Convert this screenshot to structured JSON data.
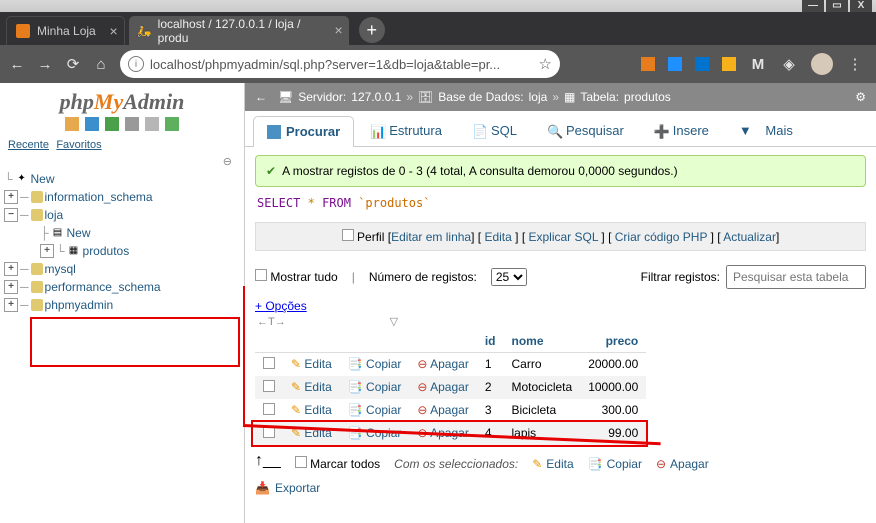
{
  "window_buttons": {
    "min": "—",
    "max": "▭",
    "close": "X"
  },
  "browser_tabs": [
    {
      "label": "Minha Loja"
    },
    {
      "label": "localhost / 127.0.0.1 / loja / produ"
    }
  ],
  "url": "localhost/phpmyadmin/sql.php?server=1&db=loja&table=pr...",
  "logo": {
    "php": "php",
    "my": "My",
    "admin": "Admin"
  },
  "sidebar_tabs": {
    "recent": "Recente",
    "fav": "Favoritos"
  },
  "tree": {
    "new": "New",
    "dbs": [
      "information_schema",
      "loja",
      "mysql",
      "performance_schema",
      "phpmyadmin"
    ],
    "loja_new": "New",
    "loja_table": "produtos"
  },
  "breadcrumb": {
    "server_label": "Servidor:",
    "server": "127.0.0.1",
    "db_label": "Base de Dados:",
    "db": "loja",
    "table_label": "Tabela:",
    "table": "produtos"
  },
  "tabs": {
    "browse": "Procurar",
    "structure": "Estrutura",
    "sql": "SQL",
    "search": "Pesquisar",
    "insert": "Insere",
    "more": "Mais"
  },
  "alert": "A mostrar registos de 0 - 3 (4 total, A consulta demorou 0,0000 segundos.)",
  "sql": {
    "select": "SELECT",
    "star": "*",
    "from": "FROM",
    "tbl": "`produtos`"
  },
  "inline": {
    "profile": "Perfil",
    "edit_inline": "Editar em linha",
    "edit": "Edita",
    "explain": "Explicar SQL",
    "php": "Criar código PHP",
    "refresh": "Actualizar"
  },
  "filters": {
    "show_all": "Mostrar tudo",
    "num_rows_label": "Número de registos:",
    "num_rows": "25",
    "filter_label": "Filtrar registos:",
    "filter_ph": "Pesquisar esta tabela"
  },
  "options": "+ Opções",
  "columns": {
    "id": "id",
    "nome": "nome",
    "preco": "preco"
  },
  "row_actions": {
    "edit": "Edita",
    "copy": "Copiar",
    "delete": "Apagar"
  },
  "rows": [
    {
      "id": "1",
      "nome": "Carro",
      "preco": "20000.00"
    },
    {
      "id": "2",
      "nome": "Motocicleta",
      "preco": "10000.00"
    },
    {
      "id": "3",
      "nome": "Bicicleta",
      "preco": "300.00"
    },
    {
      "id": "4",
      "nome": "lapis",
      "preco": "99.00"
    }
  ],
  "bulk": {
    "check_all": "Marcar todos",
    "with_selected": "Com os seleccionados:",
    "edit": "Edita",
    "copy": "Copiar",
    "delete": "Apagar"
  },
  "export": "Exportar"
}
